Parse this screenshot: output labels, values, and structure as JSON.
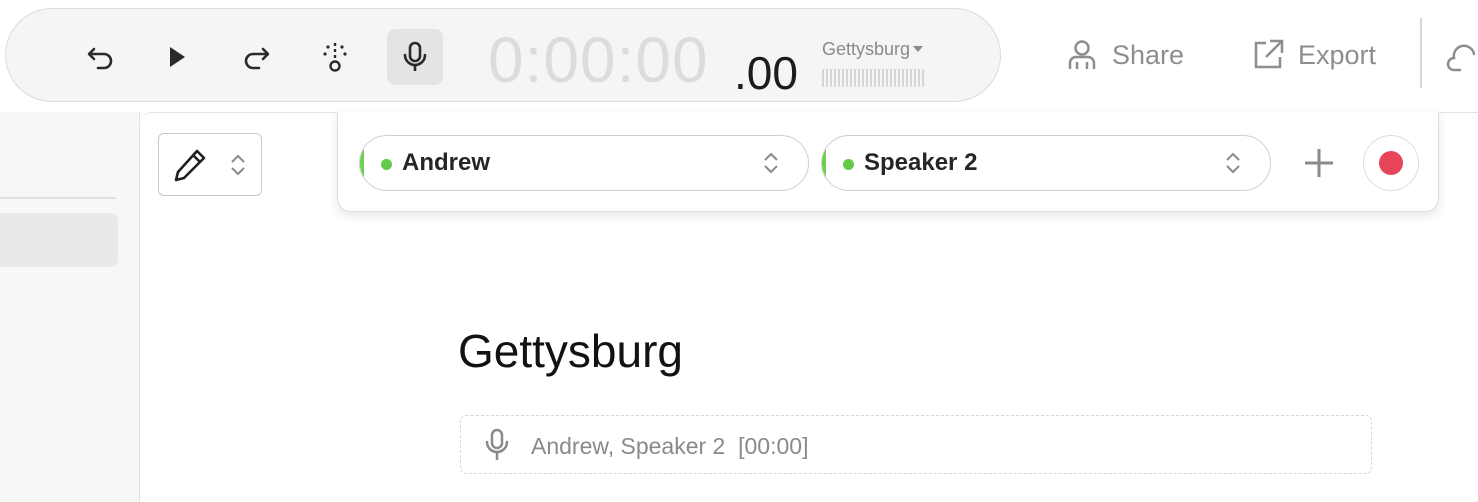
{
  "toolbar": {
    "time_main": "0:00:00",
    "time_fraction": ".00",
    "input_device": "Gettysburg",
    "share_label": "Share",
    "export_label": "Export"
  },
  "speakers": [
    {
      "name": "Andrew",
      "color": "#62c94a"
    },
    {
      "name": "Speaker 2",
      "color": "#62c94a"
    }
  ],
  "document": {
    "title": "Gettysburg",
    "segment_speakers": "Andrew, Speaker 2",
    "segment_time": "[00:00]"
  },
  "colors": {
    "accent_record": "#e9455a",
    "speaker_active": "#62c94a"
  }
}
